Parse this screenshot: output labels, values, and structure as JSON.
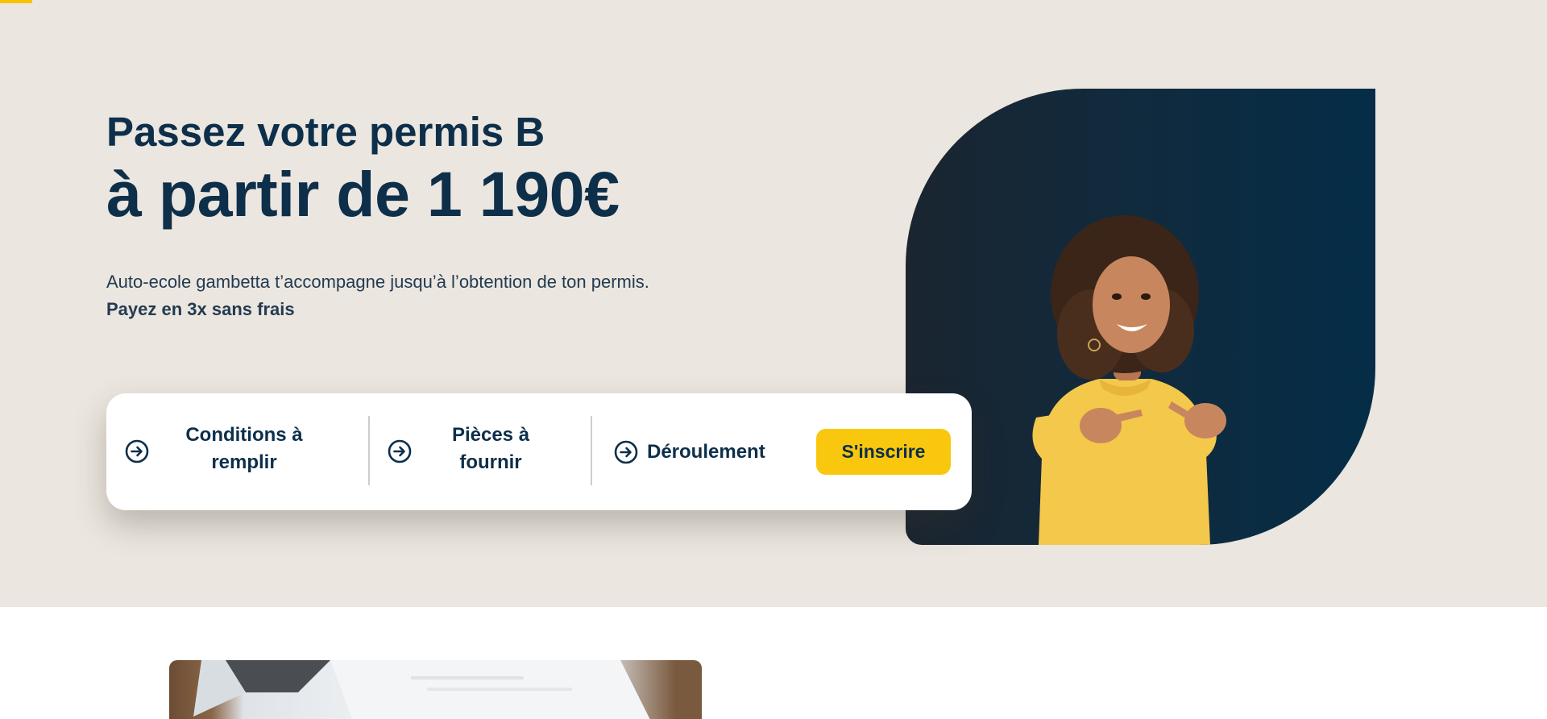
{
  "hero": {
    "headline_line1": "Passez votre permis B",
    "headline_line2": "à partir de 1 190€",
    "subtitle": "Auto-ecole gambetta t’accompagne jusqu’à l’obtention de ton permis.",
    "payment_note": "Payez en 3x sans frais"
  },
  "nav_card": {
    "items": [
      {
        "line1": "Conditions à",
        "line2": "remplir",
        "icon": "arrow-circle-right-icon"
      },
      {
        "line1": "Pièces à",
        "line2": "fournir",
        "icon": "arrow-circle-right-icon"
      },
      {
        "line1": "Déroulement",
        "icon": "arrow-circle-right-icon"
      }
    ],
    "signup_label": "S'inscrire"
  },
  "colors": {
    "hero_background": "#ebe6df",
    "navy": "#0d2f4a",
    "accent_yellow": "#f9c80e",
    "photo_background": "#052d47",
    "sweater_yellow": "#f3c84b"
  }
}
